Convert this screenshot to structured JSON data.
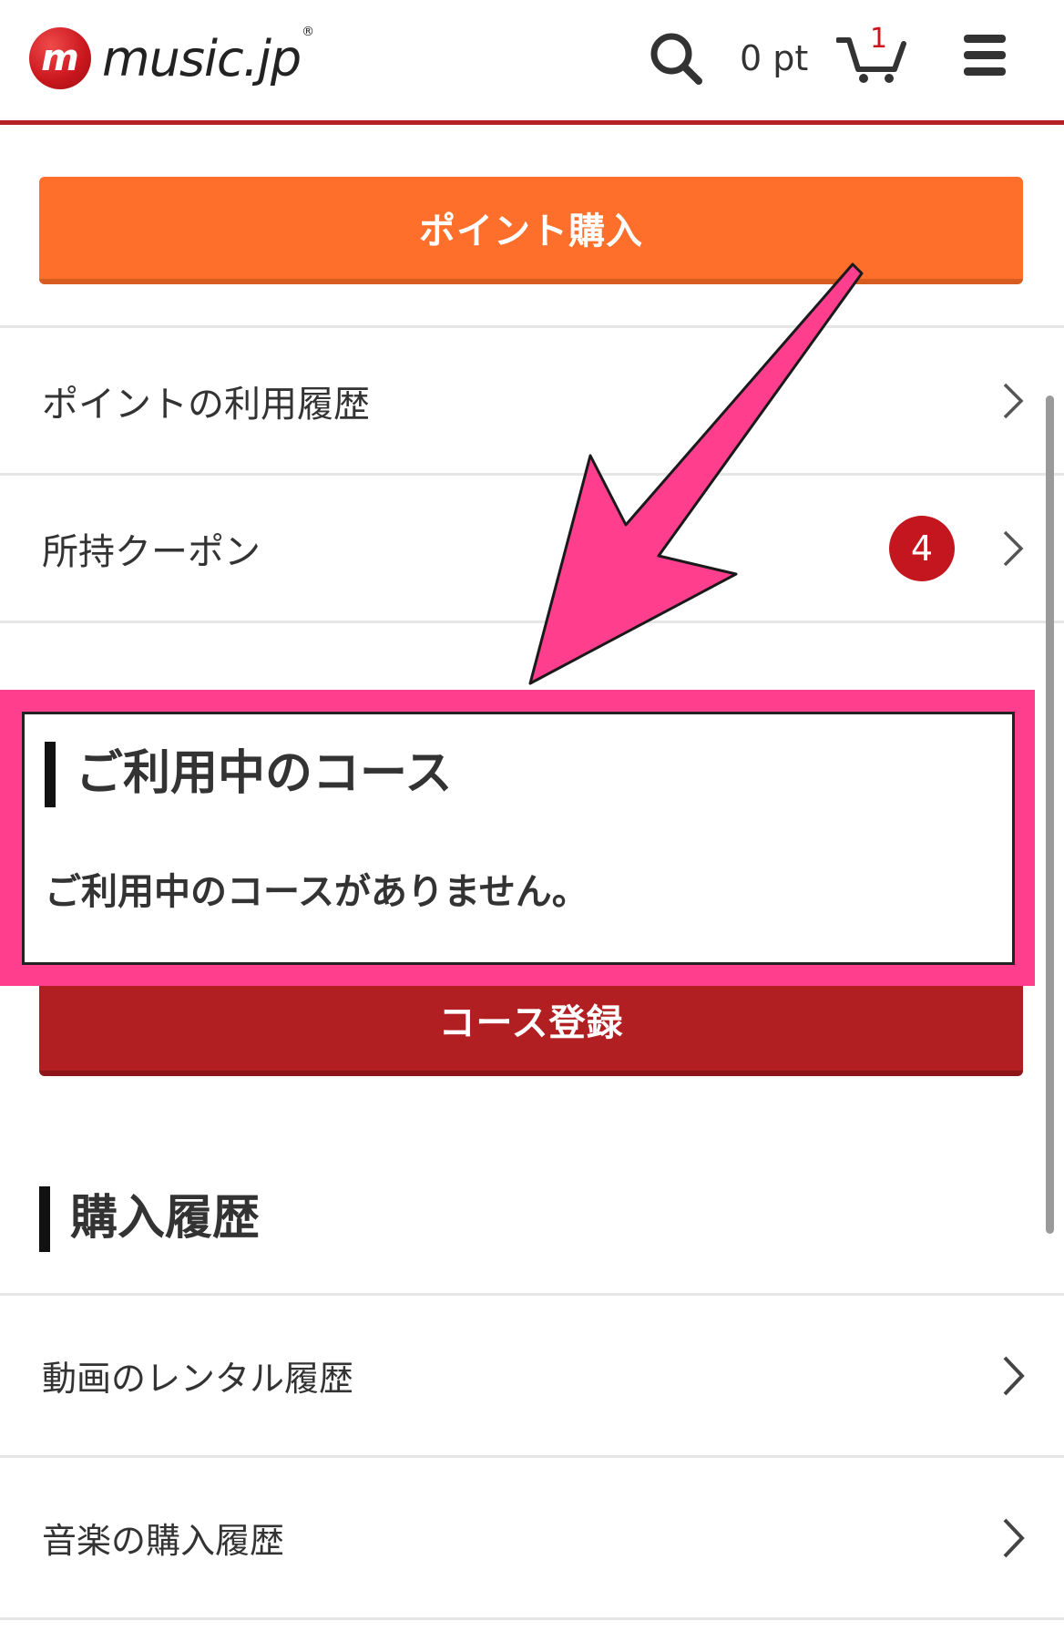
{
  "header": {
    "logo_mark": "m",
    "logo_text": "music.jp",
    "logo_reg": "®",
    "points": "0 pt",
    "cart_count": "1"
  },
  "buttons": {
    "buy_points": "ポイント購入",
    "register_course": "コース登録"
  },
  "menu": {
    "point_history": "ポイントの利用履歴",
    "coupons": "所持クーポン",
    "coupon_count": "4"
  },
  "course": {
    "title": "ご利用中のコース",
    "empty_message": "ご利用中のコースがありません。"
  },
  "history": {
    "title": "購入履歴",
    "items": [
      "動画のレンタル履歴",
      "音楽の購入履歴"
    ]
  },
  "colors": {
    "brand_red": "#b52025",
    "orange": "#ff6f2c",
    "highlight_pink": "#ff3f8e"
  }
}
